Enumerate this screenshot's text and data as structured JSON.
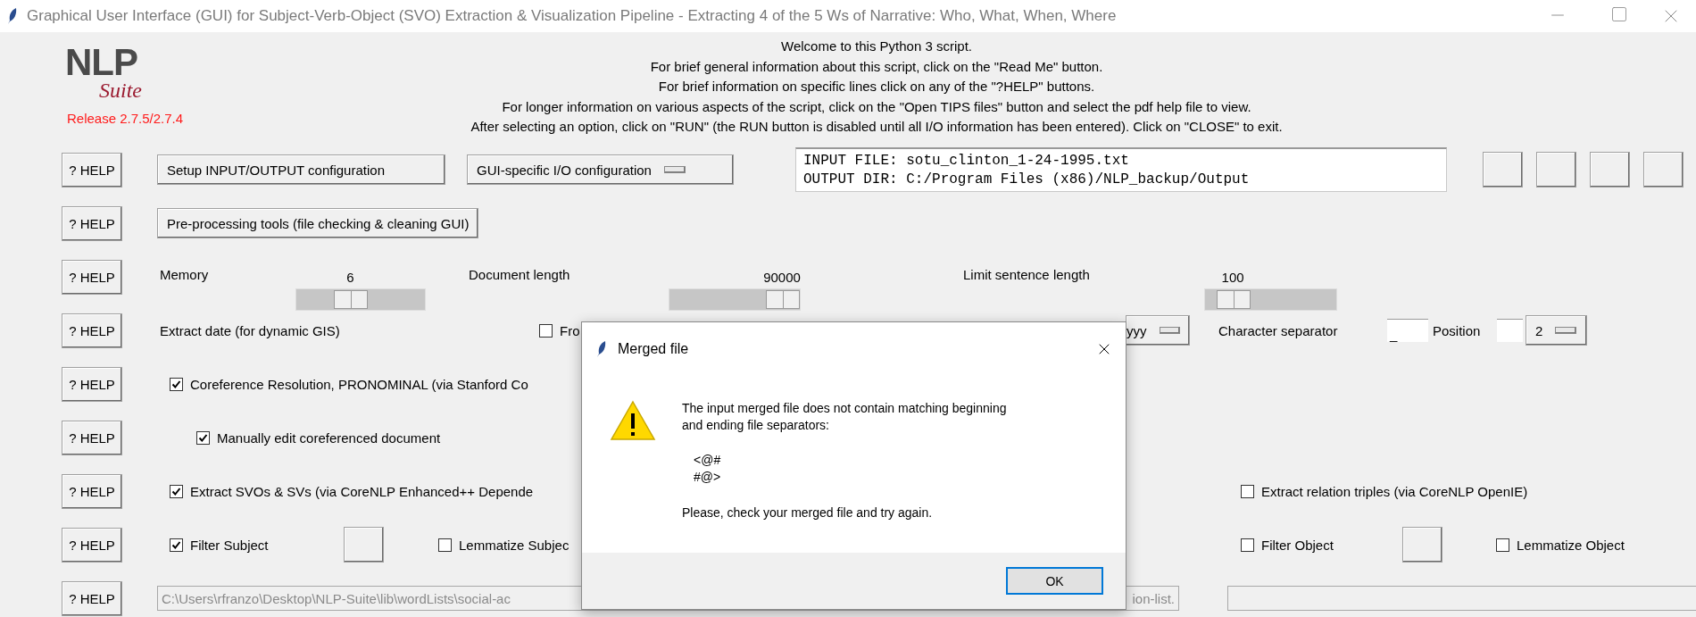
{
  "window": {
    "title": "Graphical User Interface (GUI) for Subject-Verb-Object (SVO) Extraction & Visualization Pipeline - Extracting 4 of the 5 Ws of Narrative: Who, What, When, Where"
  },
  "logo": {
    "main": "NLP",
    "sub": "Suite"
  },
  "release": "Release 2.7.5/2.7.4",
  "welcome": [
    "Welcome to this Python 3 script.",
    "For brief general information about this script, click on the \"Read Me\" button.",
    "For brief information on specific lines click on any of the \"?HELP\" buttons.",
    "For longer information on various aspects of the script, click on the \"Open TIPS files\" button and select the pdf help file to view.",
    "After selecting an option, click on \"RUN\" (the RUN button is disabled until all I/O information has been entered).   Click on \"CLOSE\" to exit."
  ],
  "rows": [
    {
      "kind": "io",
      "help": "? HELP",
      "setup_button": "Setup INPUT/OUTPUT configuration",
      "io_menu": "GUI-specific I/O configuration",
      "io_lines": [
        "INPUT FILE: sotu_clinton_1-24-1995.txt",
        "OUTPUT DIR: C:/Program Files (x86)/NLP_backup/Output"
      ]
    },
    {
      "kind": "tools",
      "help": "? HELP",
      "tools_button": "Pre-processing tools (file checking & cleaning GUI)"
    },
    {
      "kind": "sliders",
      "help": "? HELP",
      "sliders": [
        {
          "label": "Memory",
          "reading": "6",
          "level": 0.4
        },
        {
          "label": "Document length",
          "reading": "90000",
          "level": 1
        },
        {
          "label": "Limit sentence length",
          "reading": "100",
          "level": 0.12
        }
      ]
    },
    {
      "kind": "date",
      "help": "? HELP",
      "label": "Extract date (for dynamic GIS)",
      "check": {
        "label": "Fro",
        "checked": false
      },
      "format_menu": "yyy",
      "separator_label": "Character separator",
      "separator_value": "_",
      "position_label": "Position",
      "position_menu": "2"
    },
    {
      "kind": "check",
      "help": "? HELP",
      "checks": [
        {
          "label": "Coreference Resolution, PRONOMINAL (via Stanford Co",
          "checked": true
        }
      ]
    },
    {
      "kind": "subcheck",
      "help": "? HELP",
      "checks": [
        {
          "label": "Manually edit coreferenced document",
          "checked": true
        }
      ]
    },
    {
      "kind": "check",
      "help": "? HELP",
      "checks": [
        {
          "label": "Extract SVOs & SVs (via CoreNLP Enhanced++ Depende",
          "checked": true
        },
        {
          "label": "Extract relation triples (via CoreNLP OpenIE)",
          "checked": false
        }
      ]
    },
    {
      "kind": "filters",
      "help": "? HELP",
      "checks": [
        {
          "label": "Filter Subject",
          "checked": true
        },
        {
          "label": "Lemmatize Subjec",
          "checked": false
        },
        {
          "label": "Filter Object",
          "checked": false
        },
        {
          "label": "Lemmatize Object",
          "checked": false
        }
      ]
    },
    {
      "kind": "paths",
      "help": "? HELP",
      "path_start": "C:\\Users\\rfranzo\\Desktop\\NLP-Suite\\lib\\wordLists\\social-ac",
      "path_end": "ion-list.",
      "disabled": true
    }
  ],
  "dialog": {
    "title": "Merged file",
    "message": [
      "The input merged file does not contain matching beginning",
      "and ending file separators:"
    ],
    "separators": [
      "<@#",
      "#@>"
    ],
    "note": "Please, check your merged file and try again.",
    "button": "OK"
  }
}
